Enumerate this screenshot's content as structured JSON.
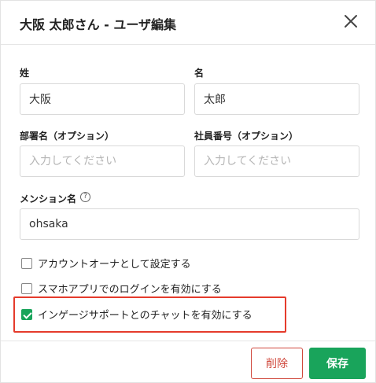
{
  "dialog": {
    "title": "大阪 太郎さん - ユーザ編集",
    "close_icon": "close-icon"
  },
  "fields": {
    "last_name": {
      "label": "姓",
      "value": "大阪"
    },
    "first_name": {
      "label": "名",
      "value": "太郎"
    },
    "department": {
      "label": "部署名（オプション）",
      "value": "",
      "placeholder": "入力してください"
    },
    "employee_no": {
      "label": "社員番号（オプション）",
      "value": "",
      "placeholder": "入力してください"
    },
    "mention": {
      "label": "メンション名",
      "value": "ohsaka",
      "help_icon": "?"
    }
  },
  "checkboxes": [
    {
      "label": "アカウントオーナとして設定する",
      "checked": false
    },
    {
      "label": "スマホアプリでのログインを有効にする",
      "checked": false
    },
    {
      "label": "インゲージサポートとのチャットを有効にする",
      "checked": true
    }
  ],
  "highlight_color": "#e53b2c",
  "footer": {
    "delete_label": "削除",
    "save_label": "保存"
  },
  "colors": {
    "primary": "#19a45b",
    "danger": "#d0483c"
  }
}
